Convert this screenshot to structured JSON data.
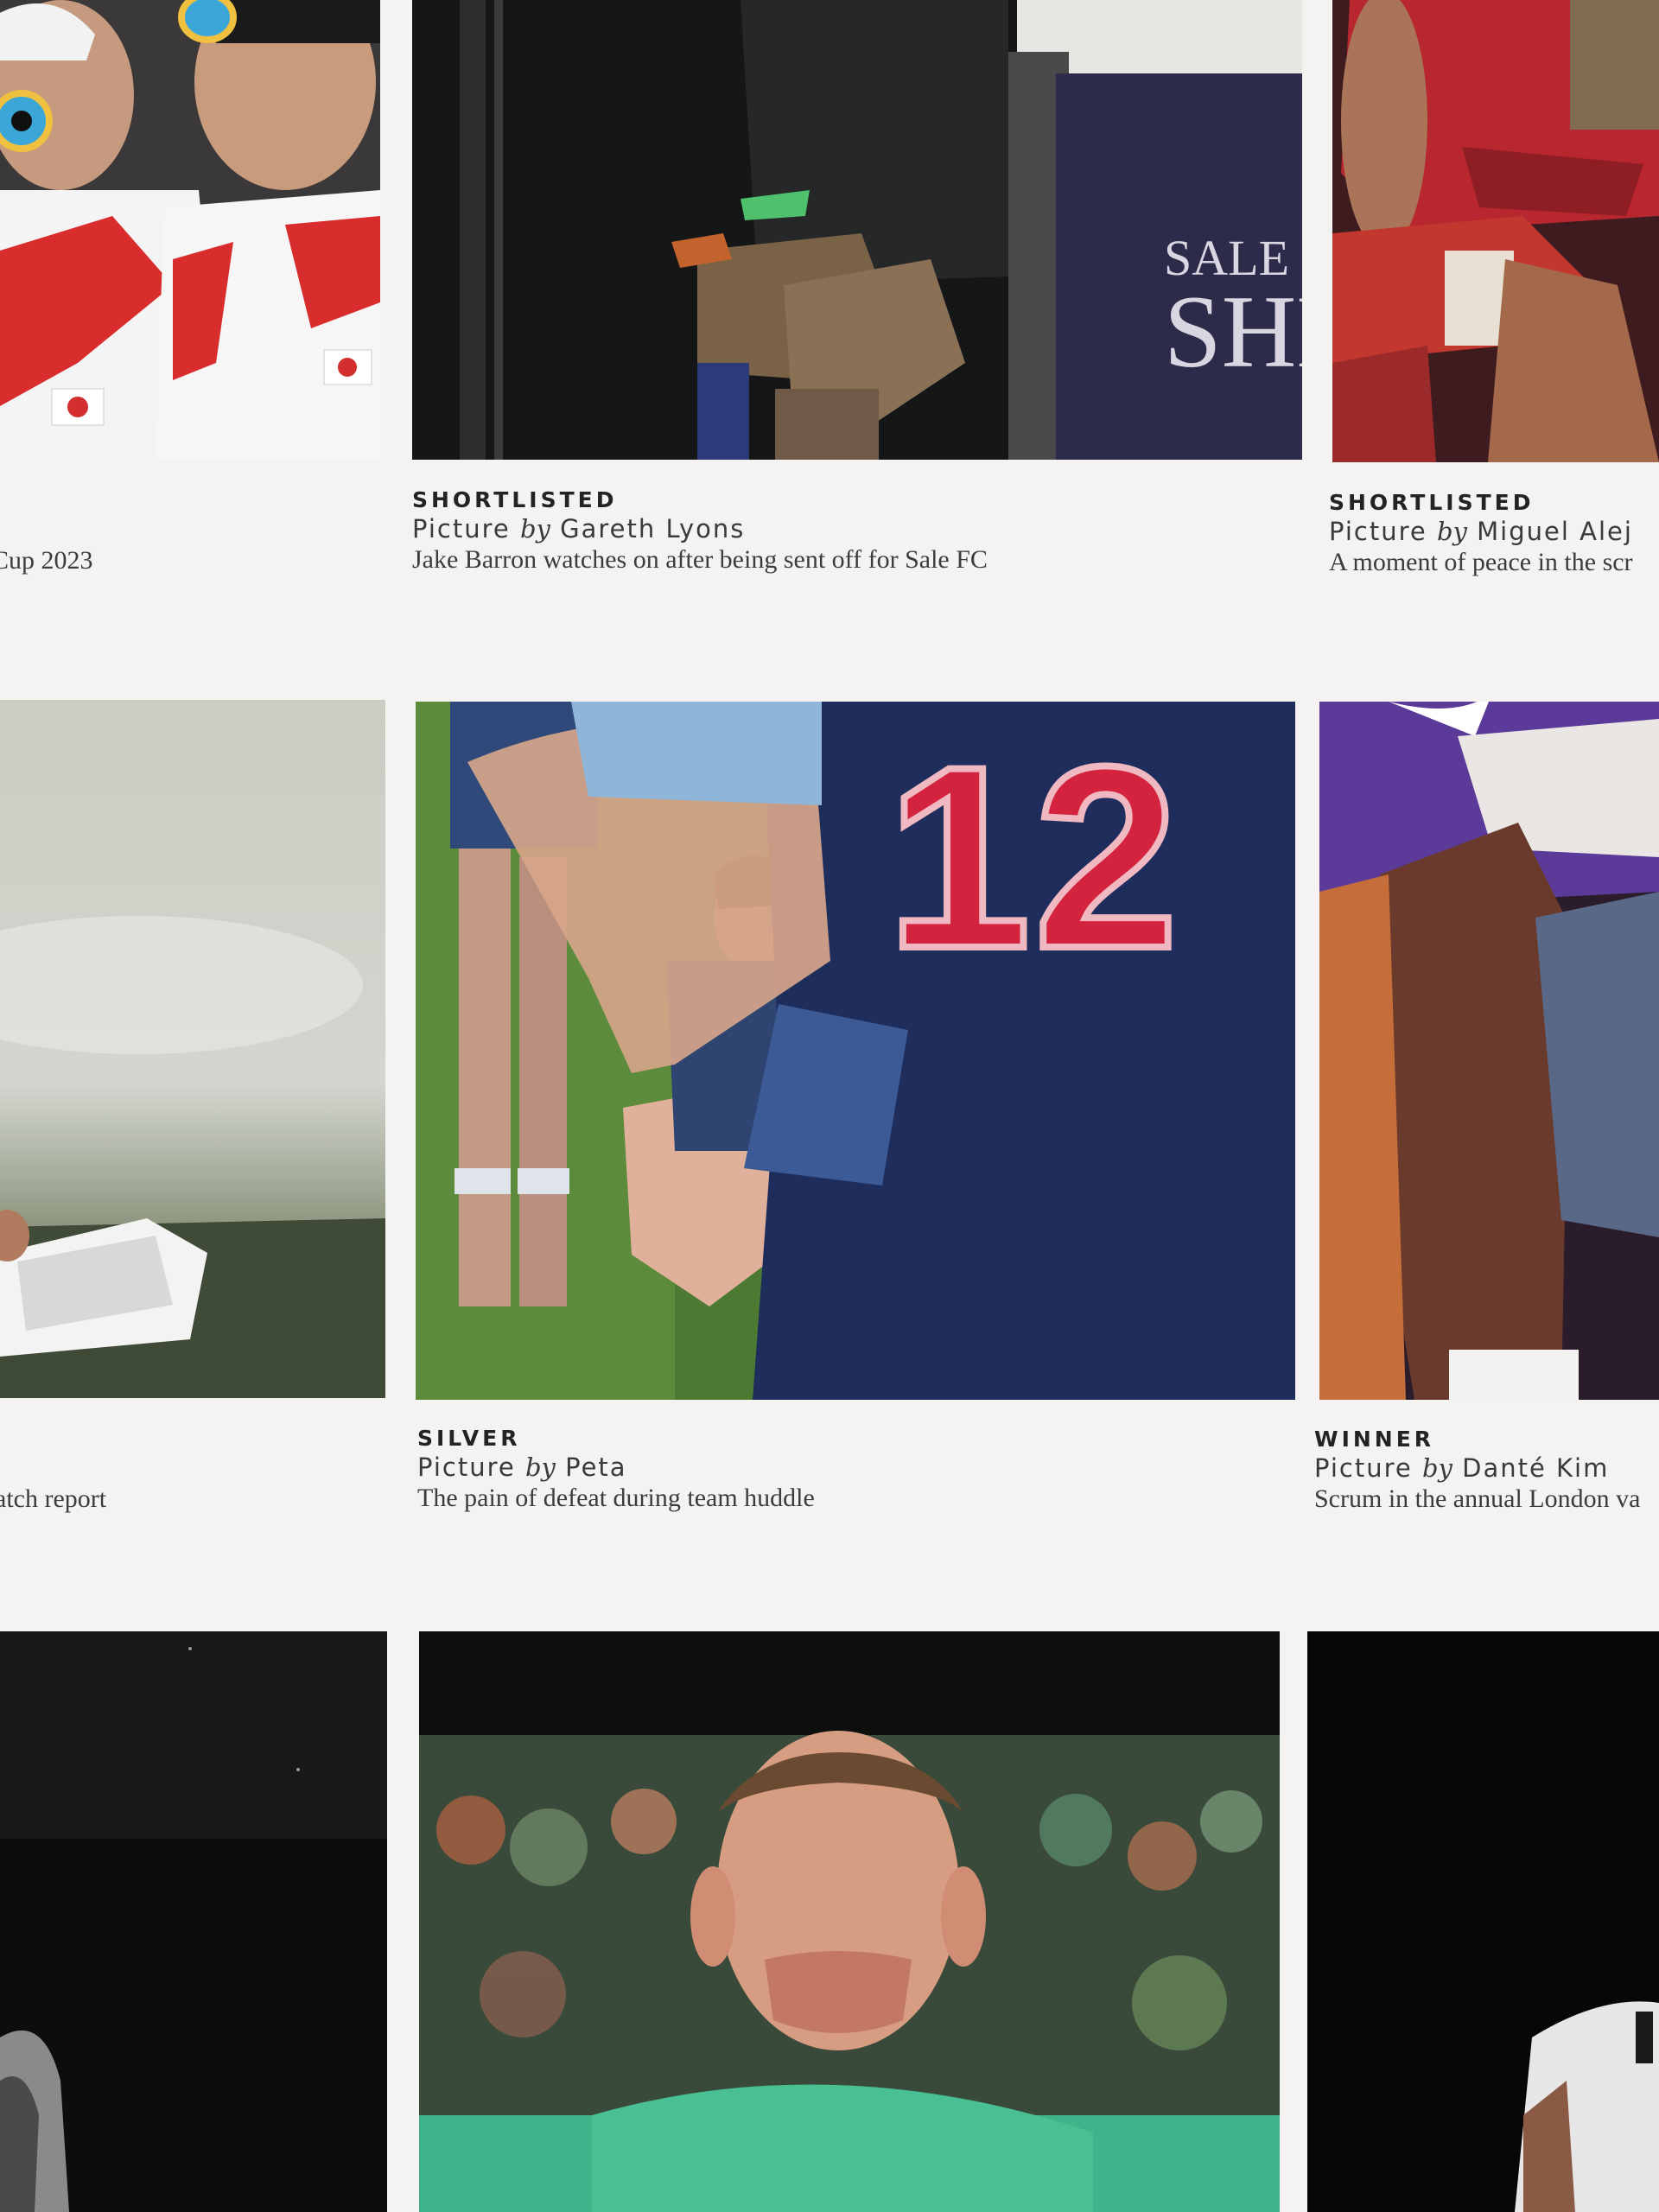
{
  "entries": [
    {
      "id": "r1c1",
      "description": "Cup 2023"
    },
    {
      "id": "r1c2",
      "award": "SHORTLISTED",
      "credit_prefix": "Picture",
      "credit_by": "by",
      "photographer": "Gareth Lyons",
      "description": "Jake Barron watches on after being sent off for Sale FC",
      "sign_text_1": "SALE",
      "sign_text_2": "SHN"
    },
    {
      "id": "r1c3",
      "award": "SHORTLISTED",
      "credit_prefix": "Picture",
      "credit_by": "by",
      "photographer": "Miguel Alej",
      "description": "A moment of peace in the scr"
    },
    {
      "id": "r2c1",
      "description": "atch report"
    },
    {
      "id": "r2c2",
      "award": "SILVER",
      "credit_prefix": "Picture",
      "credit_by": "by",
      "photographer": "Peta",
      "description": "The pain of defeat during team huddle",
      "jersey_number": "12"
    },
    {
      "id": "r2c3",
      "award": "WINNER",
      "credit_prefix": "Picture",
      "credit_by": "by",
      "photographer": "Danté Kim",
      "description": "Scrum in the annual London va"
    },
    {
      "id": "r3c1"
    },
    {
      "id": "r3c2"
    },
    {
      "id": "r3c3"
    }
  ],
  "colors": {
    "paper": "#f4f3f1",
    "caption_text": "#2a2a2a",
    "jersey_navy": "#1e2d5c",
    "jersey_number_red": "#d4233f",
    "kit_red": "#b8262f",
    "kit_purple": "#5b3a9a",
    "kit_green": "#3fb48a"
  }
}
